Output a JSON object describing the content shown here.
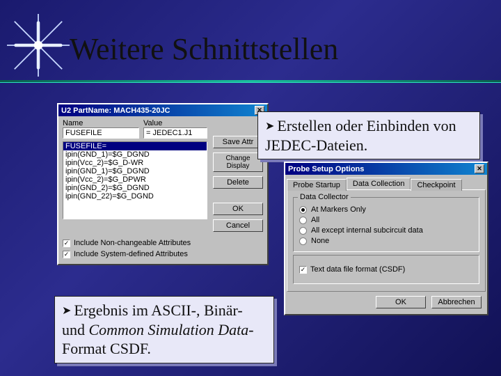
{
  "slide": {
    "title": "Weitere Schnittstellen"
  },
  "callouts": {
    "c1_arrow": "➤",
    "c1_text": "Erstellen oder Einbinden von JEDEC-Dateien.",
    "c2_arrow": "➤",
    "c2_prefix": "Ergebnis im ASCII-, Binär- und ",
    "c2_italic": "Common Simulation Data-",
    "c2_suffix": "Format CSDF."
  },
  "dialogA": {
    "title": "U2  PartName: MACH435-20JC",
    "labels": {
      "name": "Name",
      "value": "Value"
    },
    "name_value": "FUSEFILE",
    "value_value": "= JEDEC1.J1",
    "list_header": "FUSEFILE=",
    "list_items": [
      "ipin(GND_1)=$G_DGND",
      "ipin(Vcc_2)=$G_D-WR",
      "ipin(GND_1)=$G_DGND",
      "ipin(Vcc_2)=$G_DPWR",
      "ipin(GND_2)=$G_DGND",
      "ipin(GND_22)=$G_DGND"
    ],
    "buttons": {
      "save_attr": "Save Attr",
      "change_display": "Change Display",
      "delete": "Delete",
      "ok": "OK",
      "cancel": "Cancel"
    },
    "checks": {
      "nonchg": "Include Non-changeable Attributes",
      "sysdef": "Include System-defined Attributes"
    }
  },
  "dialogB": {
    "title": "Probe Setup Options",
    "tabs": {
      "t1": "Probe Startup",
      "t2": "Data Collection",
      "t3": "Checkpoint"
    },
    "groups": {
      "collector": "Data Collector"
    },
    "radios": {
      "r1": "At Markers Only",
      "r2": "All",
      "r3": "All except internal subcircuit data",
      "r4": "None"
    },
    "csdf_check": "Text data file format (CSDF)",
    "buttons": {
      "ok": "OK",
      "cancel": "Abbrechen"
    }
  }
}
